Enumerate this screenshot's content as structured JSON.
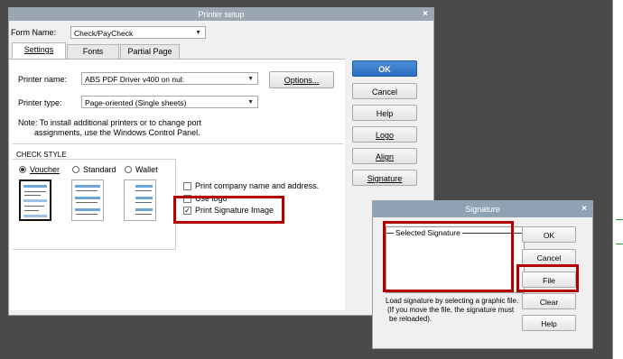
{
  "printer_setup": {
    "title": "Printer setup",
    "close_glyph": "×",
    "form_name_label": "Form Name:",
    "form_name_value": "Check/PayCheck",
    "tabs": [
      {
        "label": "Settings"
      },
      {
        "label": "Fonts"
      },
      {
        "label": "Partial Page"
      }
    ],
    "printer_name_label": "Printer name:",
    "printer_name_value": "ABS PDF Driver v400 on nul:",
    "options_button": "Options...",
    "printer_type_label": "Printer type:",
    "printer_type_value": "Page-oriented (Single sheets)",
    "note_line1": "Note: To install additional printers or to change port",
    "note_line2": "assignments, use the Windows Control Panel.",
    "check_style_heading": "CHECK STYLE",
    "styles": [
      {
        "label": "Voucher",
        "selected": true
      },
      {
        "label": "Standard",
        "selected": false
      },
      {
        "label": "Wallet",
        "selected": false
      }
    ],
    "options": [
      {
        "label": "Print company name and address.",
        "checked": false
      },
      {
        "label": "Use logo",
        "checked": false
      },
      {
        "label": "Print Signature Image",
        "checked": true
      }
    ],
    "buttons": {
      "ok": "OK",
      "cancel": "Cancel",
      "help": "Help",
      "logo": "Logo",
      "align": "Align",
      "signature": "Signature"
    }
  },
  "signature_dialog": {
    "title": "Signature",
    "close_glyph": "×",
    "selected_signature_label": "Selected Signature",
    "hint_line1": "Load signature by selecting a graphic file.",
    "hint_line2": "(If you move the file, the signature must",
    "hint_line3": "be reloaded).",
    "buttons": {
      "ok": "OK",
      "cancel": "Cancel",
      "file": "File",
      "clear": "Clear",
      "help": "Help"
    }
  },
  "colors": {
    "highlight_red": "#b00000",
    "primary_blue": "#2a6cc0",
    "titlebar": "#9aa7b3"
  },
  "icons": {
    "combo_arrow": "▼",
    "check_mark": "✓"
  }
}
